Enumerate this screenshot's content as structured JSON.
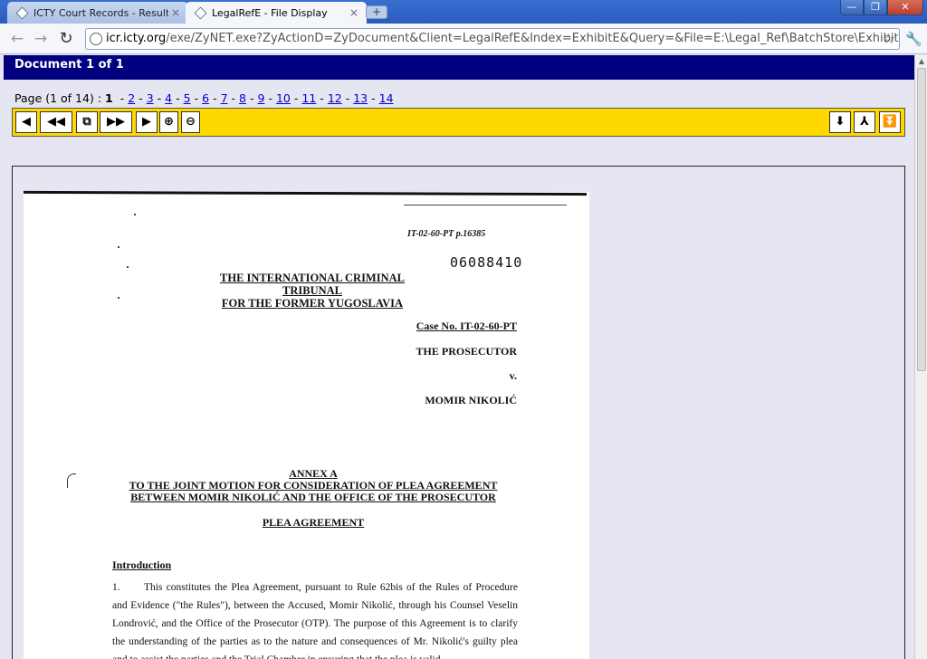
{
  "browser": {
    "tabs": [
      {
        "label": "ICTY Court Records - Results",
        "close": "×"
      },
      {
        "label": "LegalRefE - File Display",
        "close": "×"
      }
    ],
    "new_tab": "+",
    "window_controls": {
      "minimize": "—",
      "maximize": "❐",
      "close": "✕"
    },
    "nav": {
      "back": "←",
      "forward": "→",
      "reload": "↻"
    },
    "url_domain": "icr.icty.org",
    "url_path": "/exe/ZyNET.exe?ZyActionD=ZyDocument&Client=LegalRefE&Index=ExhibitE&Query=&File=E:\\Legal_Ref\\BatchStore\\Exhibit\\Er",
    "star": "☆",
    "wrench": "🔧"
  },
  "document": {
    "header": "Document 1 of 1",
    "page_label": "Page (1 of 14) :",
    "current_page": "1",
    "pages": [
      "2",
      "3",
      "4",
      "5",
      "6",
      "7",
      "8",
      "9",
      "10",
      "11",
      "12",
      "13",
      "14"
    ]
  },
  "viewer_toolbar": {
    "first": "◀",
    "prev": "◀◀",
    "fit": "⧉",
    "next": "▶▶",
    "last": "▶",
    "zoom_in": "⊕",
    "zoom_out": "⊖",
    "download": "⬇",
    "pdf": "⅄",
    "expand": "⏬"
  },
  "paper": {
    "stamp1": "IT-02-60-PT p.16385",
    "stamp2": "06088410",
    "title_line1": "THE INTERNATIONAL CRIMINAL TRIBUNAL",
    "title_line2": "FOR THE FORMER YUGOSLAVIA",
    "case_no": "Case No. IT-02-60-PT",
    "prosecutor": "THE PROSECUTOR",
    "vs": "v.",
    "accused": "MOMIR NIKOLIĆ",
    "annex_line1": "ANNEX A",
    "annex_line2": "TO THE JOINT MOTION FOR CONSIDERATION OF PLEA AGREEMENT",
    "annex_line3": "BETWEEN MOMIR NIKOLIĆ AND THE OFFICE OF THE PROSECUTOR",
    "plea": "PLEA AGREEMENT",
    "intro": "Introduction",
    "para_num": "1.",
    "para_text": "This constitutes the Plea Agreement, pursuant to Rule 62bis of the Rules of Procedure and Evidence (\"the Rules\"), between the Accused, Momir Nikolić, through his Counsel Veselin Londrović, and the Office of the Prosecutor (OTP).  The purpose of this Agreement is to clarify the understanding of the parties as to the nature and consequences of Mr. Nikolić's guilty plea and to assist the parties and the Trial Chamber in ensuring that the plea is valid."
  }
}
